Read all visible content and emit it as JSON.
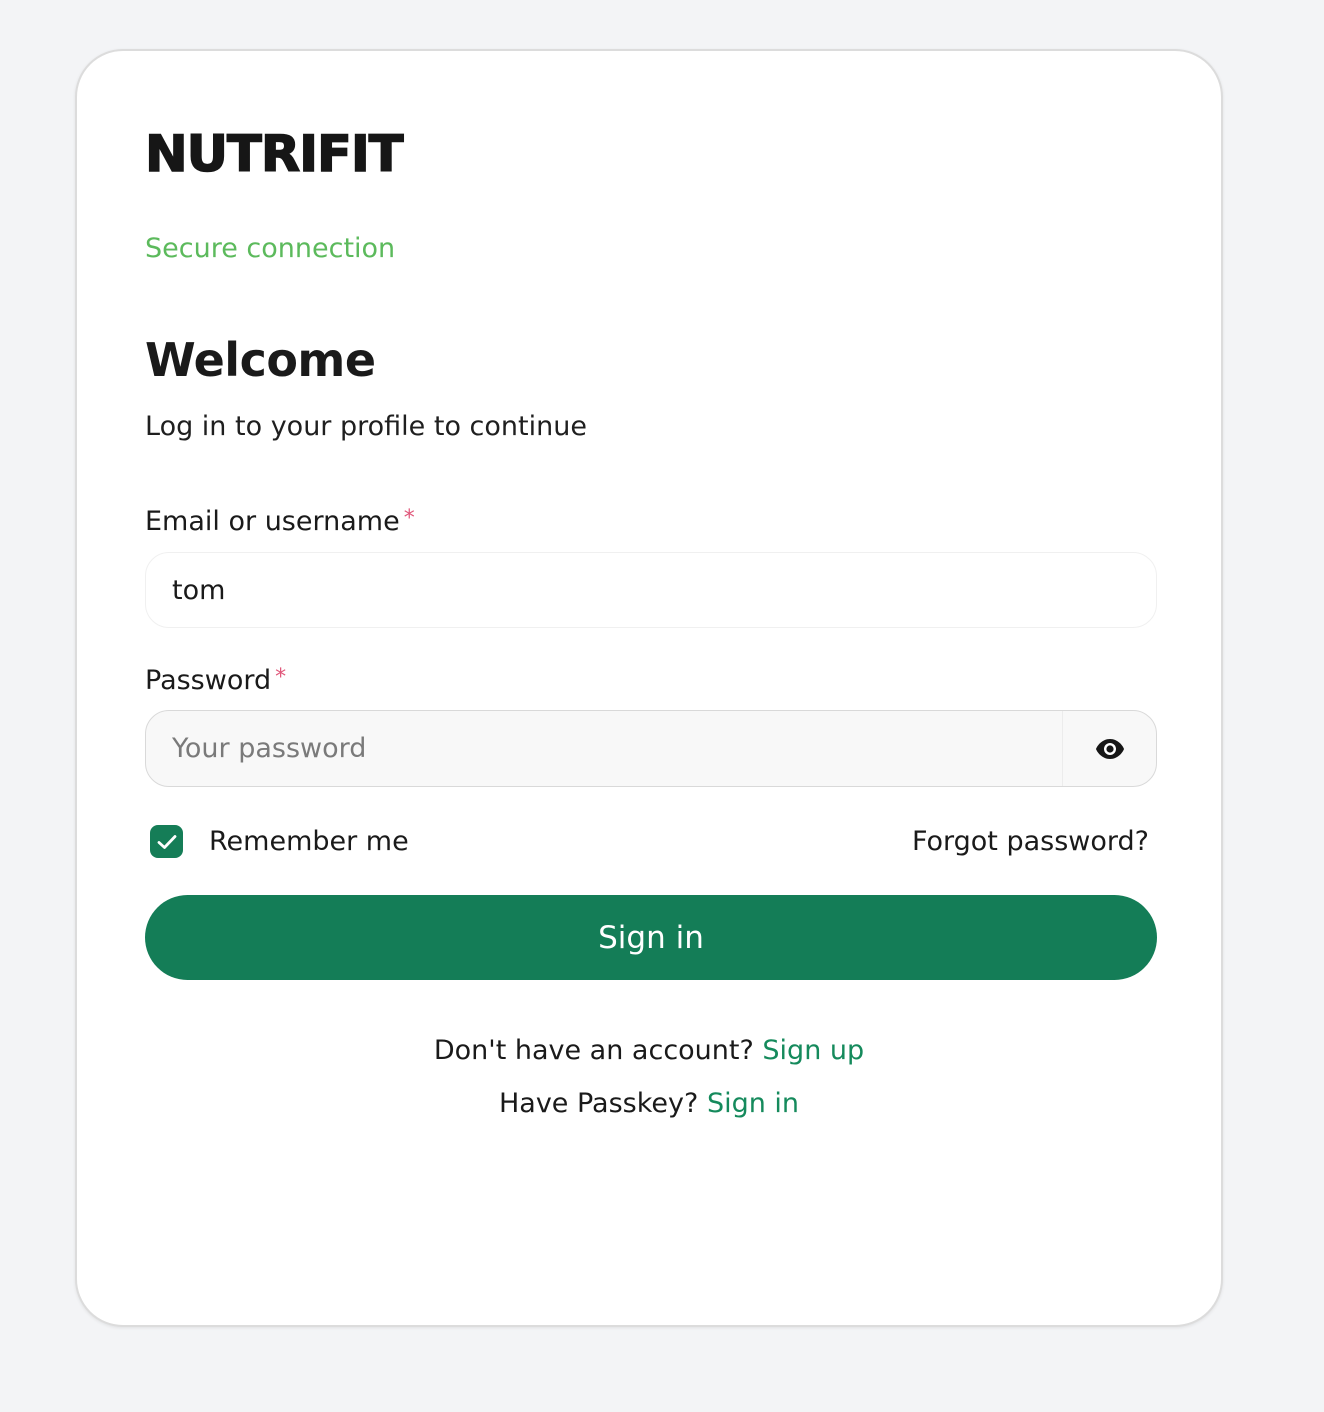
{
  "brand": {
    "logo_text": "NUTRIFIT"
  },
  "secure_notice": "Secure connection",
  "heading": {
    "title": "Welcome",
    "subtitle": "Log in to your profile to continue"
  },
  "form": {
    "email": {
      "label": "Email or username",
      "required_mark": "*",
      "value": "tom"
    },
    "password": {
      "label": "Password",
      "required_mark": "*",
      "placeholder": "Your password",
      "toggle_icon": "eye-icon"
    },
    "remember_me": {
      "label": "Remember me",
      "checked": true
    },
    "forgot_password": "Forgot password?",
    "submit_label": "Sign in"
  },
  "footer": {
    "signup_prompt": "Don't have an account?",
    "signup_link": "Sign up",
    "passkey_prompt": "Have Passkey?",
    "passkey_link": "Sign in"
  },
  "colors": {
    "accent": "#147d57",
    "link": "#158a5c",
    "secure": "#5cba5c",
    "required": "#e0577a",
    "background": "#f3f4f6"
  }
}
